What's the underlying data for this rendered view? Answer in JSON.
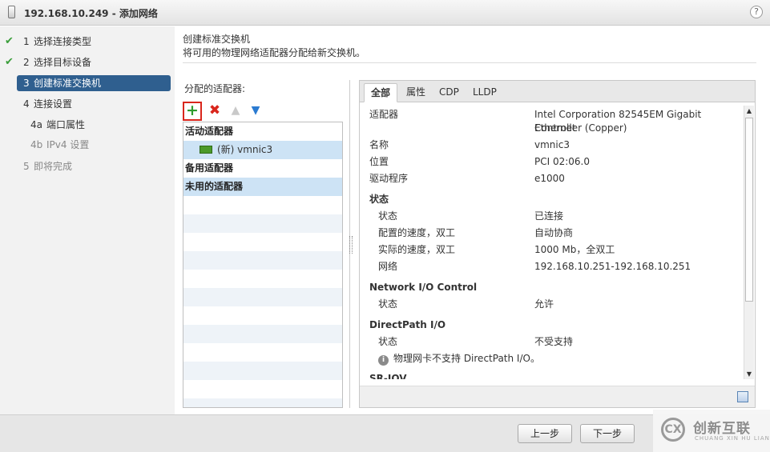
{
  "window": {
    "title": "192.168.10.249 - 添加网络",
    "help": "?"
  },
  "steps": [
    {
      "num": "1",
      "label": "选择连接类型",
      "done": true
    },
    {
      "num": "2",
      "label": "选择目标设备",
      "done": true
    },
    {
      "num": "3",
      "label": "创建标准交换机",
      "active": true
    },
    {
      "num": "4",
      "label": "连接设置"
    },
    {
      "num": "4a",
      "label": "端口属性"
    },
    {
      "num": "4b",
      "label": "IPv4 设置"
    },
    {
      "num": "5",
      "label": "即将完成"
    }
  ],
  "heading": {
    "title": "创建标准交换机",
    "subtitle": "将可用的物理网络适配器分配给新交换机。"
  },
  "adapters": {
    "label": "分配的适配器:",
    "groups": {
      "active": "活动适配器",
      "standby": "备用适配器",
      "unused": "未用的适配器"
    },
    "selected_adapter": "(新) vmnic3"
  },
  "tabs": [
    "全部",
    "属性",
    "CDP",
    "LLDP"
  ],
  "details": {
    "adapter_label": "适配器",
    "adapter_value_1": "Intel Corporation 82545EM Gigabit Ethernet",
    "adapter_value_2": "Controller (Copper)",
    "name_label": "名称",
    "name_value": "vmnic3",
    "location_label": "位置",
    "location_value": "PCI 02:06.0",
    "driver_label": "驱动程序",
    "driver_value": "e1000",
    "status_section": "状态",
    "status_label": "状态",
    "status_value": "已连接",
    "cfg_speed_label": "配置的速度，双工",
    "cfg_speed_value": "自动协商",
    "act_speed_label": "实际的速度，双工",
    "act_speed_value": "1000 Mb，全双工",
    "network_label": "网络",
    "network_value": "192.168.10.251-192.168.10.251",
    "nioc_section": "Network I/O Control",
    "nioc_status_label": "状态",
    "nioc_status_value": "允许",
    "dp_section": "DirectPath I/O",
    "dp_status_label": "状态",
    "dp_status_value": "不受支持",
    "dp_note": "物理网卡不支持 DirectPath I/O。",
    "sriov_section": "SR-IOV"
  },
  "buttons": {
    "back": "上一步",
    "next": "下一步"
  },
  "watermark": {
    "cn": "创新互联",
    "en": "CHUANG XIN HU LIAN",
    "logo": "CX"
  }
}
